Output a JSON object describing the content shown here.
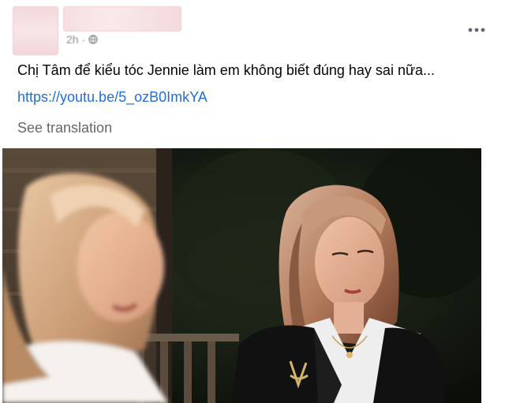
{
  "post": {
    "timestamp": "2h",
    "privacy_icon": "globe-icon",
    "more_icon": "more-horizontal-icon",
    "text": "Chị Tâm để kiểu tóc Jennie làm em không biết đúng hay sai nữa...",
    "link": "https://youtu.be/5_ozB0ImkYA",
    "see_translation": "See translation"
  },
  "colors": {
    "link": "#216fdb",
    "secondary_text": "#65676b",
    "primary_text": "#050505"
  }
}
